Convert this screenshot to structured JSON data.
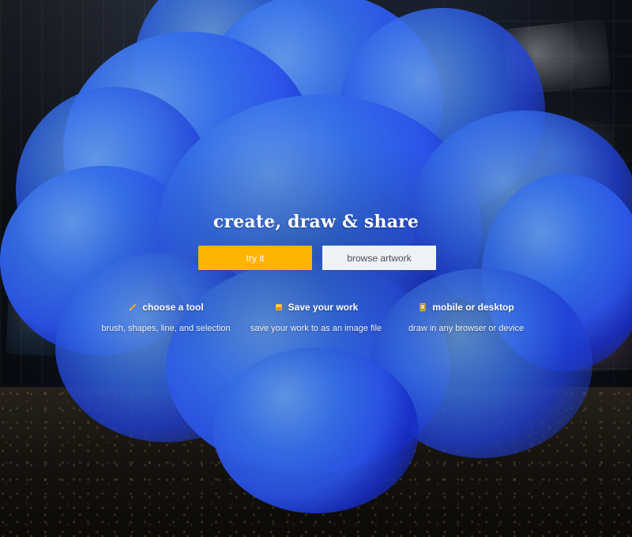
{
  "hero": {
    "title": "create, draw & share"
  },
  "buttons": {
    "primary_label": "try it",
    "secondary_label": "browse artwork"
  },
  "features": [
    {
      "icon": "pencil-icon",
      "title": "choose a tool",
      "desc": "brush, shapes, line, and selection"
    },
    {
      "icon": "save-icon",
      "title": "Save your work",
      "desc": "save your work to as an image file"
    },
    {
      "icon": "mobile-icon",
      "title": "mobile or desktop",
      "desc": "draw in any browser or device"
    }
  ],
  "colors": {
    "accent": "#ffb400",
    "smoke_blue": "#2f5cff",
    "button_secondary_bg": "#eef1f5",
    "button_secondary_text": "#4a4f57"
  }
}
